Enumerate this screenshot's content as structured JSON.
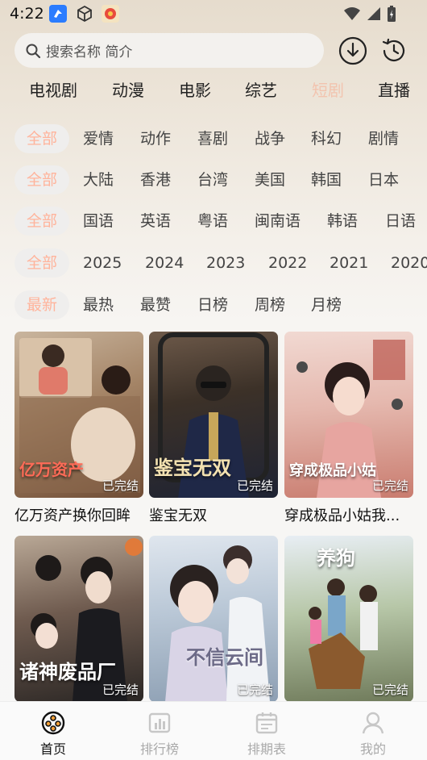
{
  "status_bar": {
    "time": "4:22"
  },
  "search": {
    "placeholder": "搜索名称 简介"
  },
  "main_nav": [
    "电视剧",
    "动漫",
    "电影",
    "综艺",
    "短剧",
    "直播"
  ],
  "filters": {
    "genre": [
      "全部",
      "爱情",
      "动作",
      "喜剧",
      "战争",
      "科幻",
      "剧情"
    ],
    "region": [
      "全部",
      "大陆",
      "香港",
      "台湾",
      "美国",
      "韩国",
      "日本"
    ],
    "language": [
      "全部",
      "国语",
      "英语",
      "粤语",
      "闽南语",
      "韩语",
      "日语"
    ],
    "year": [
      "全部",
      "2025",
      "2024",
      "2023",
      "2022",
      "2021",
      "2020"
    ],
    "sort": [
      "最新",
      "最热",
      "最赞",
      "日榜",
      "周榜",
      "月榜"
    ]
  },
  "cards": [
    {
      "title": "亿万资产换你回眸",
      "poster_text": "亿万资产",
      "status": "已完结"
    },
    {
      "title": "鉴宝无双",
      "poster_text": "鉴宝无双",
      "status": "已完结"
    },
    {
      "title": "穿成极品小姑我...",
      "poster_text": "穿成极品小姑",
      "status": "已完结"
    },
    {
      "title": "",
      "poster_text": "诸神废品厂",
      "status": "已完结"
    },
    {
      "title": "",
      "poster_text": "不信云间",
      "status": "已完结"
    },
    {
      "title": "",
      "poster_text": "养狗",
      "status": "已完结"
    }
  ],
  "tab_bar": [
    "首页",
    "排行榜",
    "排期表",
    "我的"
  ],
  "colors": {
    "accent": "#ff8a65",
    "active_chip_bg": "#efeeed",
    "active_chip_text": "#ffb49c"
  }
}
